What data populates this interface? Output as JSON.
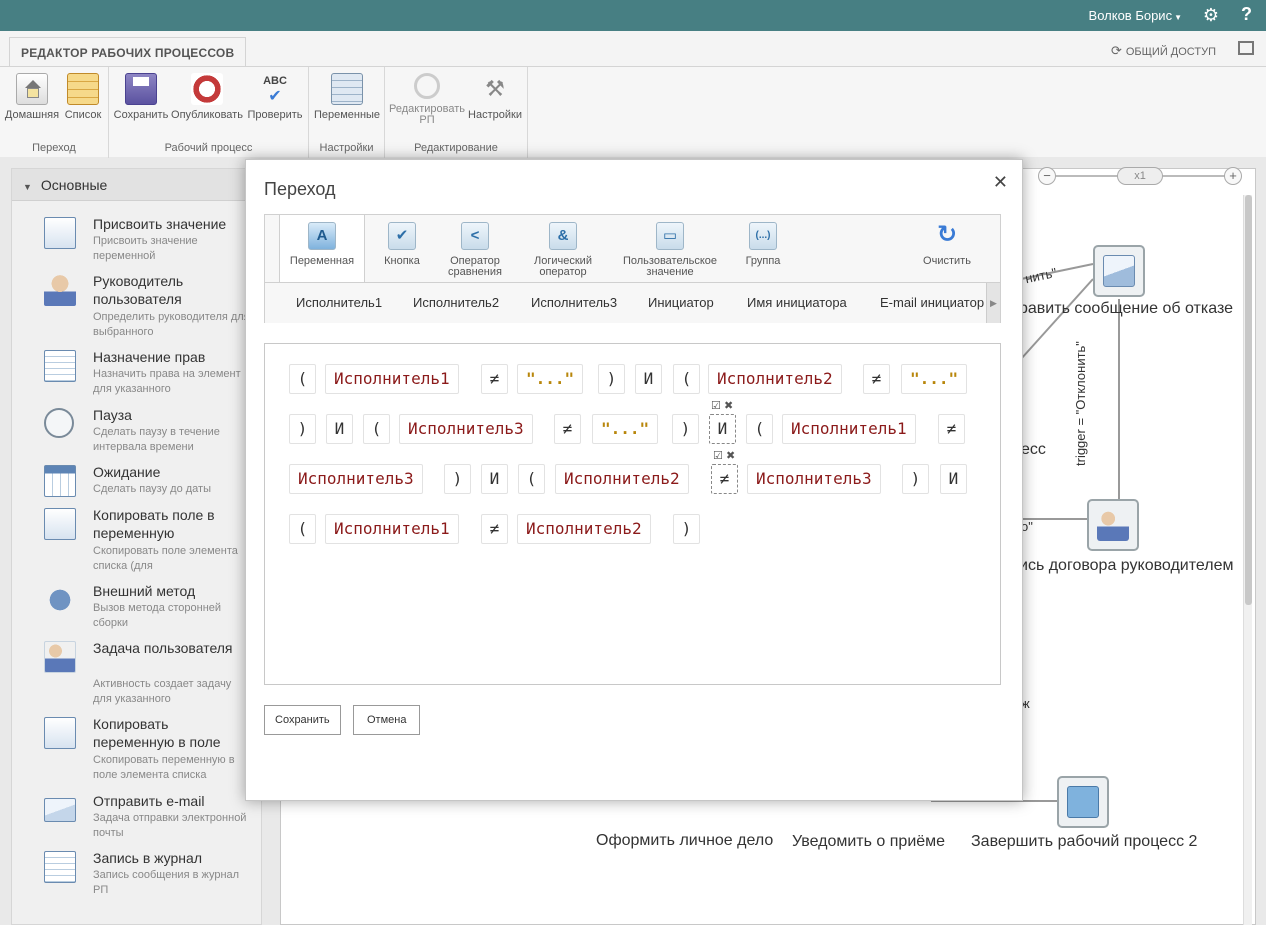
{
  "topbar": {
    "user": "Волков Борис",
    "help": "?"
  },
  "ribbon": {
    "tab": "РЕДАКТОР РАБОЧИХ ПРОЦЕССОВ",
    "share": "ОБЩИЙ ДОСТУП",
    "groups": [
      {
        "name": "Переход",
        "buttons": [
          "Домашняя",
          "Список"
        ]
      },
      {
        "name": "Рабочий процесс",
        "buttons": [
          "Сохранить",
          "Опубликовать",
          "Проверить"
        ]
      },
      {
        "name": "Настройки",
        "buttons": [
          "Переменные"
        ]
      },
      {
        "name": "Редактирование",
        "buttons": [
          "Редактировать РП",
          "Настройки"
        ]
      }
    ]
  },
  "left_panel": {
    "header": "Основные",
    "activities": [
      {
        "title": "Присвоить значение",
        "desc": "Присвоить значение переменной",
        "icon": "document-icon"
      },
      {
        "title": "Руководитель пользователя",
        "desc": "Определить руководителя для выбранного",
        "icon": "manager-icon"
      },
      {
        "title": "Назначение прав",
        "desc": "Назначить права на элемент для указанного",
        "icon": "permissions-icon"
      },
      {
        "title": "Пауза",
        "desc": "Сделать паузу в течение интервала времени",
        "icon": "clock-icon"
      },
      {
        "title": "Ожидание",
        "desc": "Сделать паузу до даты",
        "icon": "calendar-icon"
      },
      {
        "title": "Копировать поле в переменную",
        "desc": "Скопировать поле элемента списка (для",
        "icon": "copy-field-icon"
      },
      {
        "title": "Внешний метод",
        "desc": "Вызов метода сторонней сборки",
        "icon": "puzzle-icon"
      },
      {
        "title": "Задача пользователя",
        "desc": "Активность создает задачу для указанного",
        "icon": "user-task-icon"
      },
      {
        "title": "Копировать переменную в поле",
        "desc": "Скопировать переменную в поле элемента списка",
        "icon": "copy-variable-icon"
      },
      {
        "title": "Отправить e-mail",
        "desc": "Задача отправки электронной почты",
        "icon": "email-icon"
      },
      {
        "title": "Запись в журнал",
        "desc": "Запись сообщения в журнал РП",
        "icon": "journal-icon"
      }
    ]
  },
  "canvas": {
    "zoom": "x1",
    "labels": {
      "reject_msg": "равить сообщение об отказе",
      "trigger": "trigger = \"Отклонить\"",
      "sign": "ись договора руководителем",
      "ess": "есс",
      "partial1": "нить\"",
      "partial2": "о\"",
      "partial3": "ж",
      "personal": "Оформить личное дело",
      "notify": "Уведомить о приёме",
      "finish": "Завершить рабочий процесс 2"
    }
  },
  "dialog": {
    "title": "Переход",
    "tabs": [
      {
        "label": "Переменная",
        "glyph": "A",
        "active": true
      },
      {
        "label": "Кнопка",
        "glyph": "✔"
      },
      {
        "label": "Оператор сравнения",
        "glyph": "<"
      },
      {
        "label": "Логический оператор",
        "glyph": "&"
      },
      {
        "label": "Пользовательское значение",
        "glyph": "▭"
      },
      {
        "label": "Группа",
        "glyph": "(...)"
      },
      {
        "label": "Очистить",
        "glyph": "↻"
      }
    ],
    "variables": [
      "Исполнитель1",
      "Исполнитель2",
      "Исполнитель3",
      "Инициатор",
      "Имя инициатора",
      "E-mail инициатор"
    ],
    "expression": [
      [
        "(",
        "Исполнитель1",
        "≠",
        "\"...\"",
        ")",
        "И",
        "(",
        "Исполнитель2",
        "≠",
        "\"...\""
      ],
      [
        ")",
        "И",
        "(",
        "Исполнитель3",
        "≠",
        "\"...\"",
        ")",
        "И",
        "(",
        "Исполнитель1",
        "≠"
      ],
      [
        "Исполнитель3",
        ")",
        "И",
        "(",
        "Исполнитель2",
        "≠",
        "Исполнитель3",
        ")",
        "И"
      ],
      [
        "(",
        "Исполнитель1",
        "≠",
        "Исполнитель2",
        ")"
      ]
    ],
    "save": "Сохранить",
    "cancel": "Отмена"
  }
}
